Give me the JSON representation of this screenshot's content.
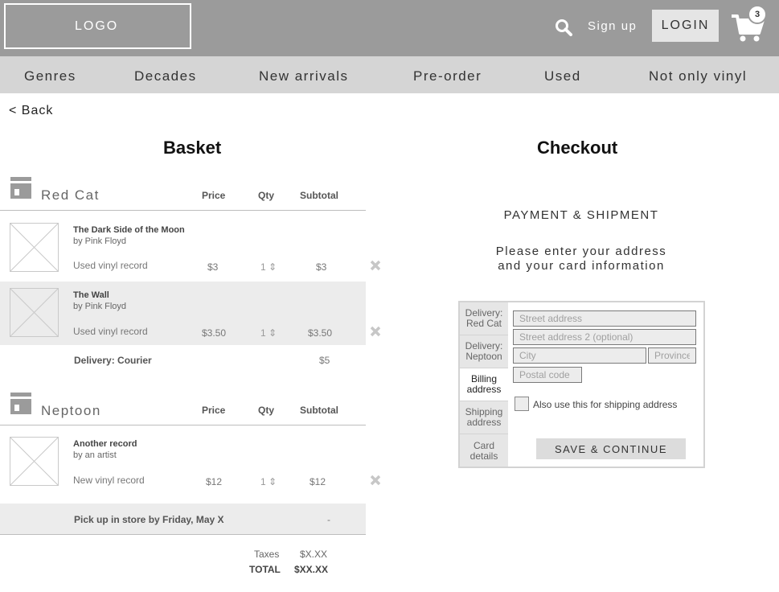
{
  "header": {
    "logo_text": "LOGO",
    "signup_label": "Sign up",
    "login_label": "LOGIN",
    "cart_count": "3",
    "icons": [
      "search-icon",
      "cart-icon"
    ]
  },
  "nav": {
    "items": [
      "Genres",
      "Decades",
      "New arrivals",
      "Pre-order",
      "Used",
      "Not only vinyl"
    ]
  },
  "back_label": "< Back",
  "basket": {
    "title": "Basket",
    "columns": {
      "price": "Price",
      "qty": "Qty",
      "subtotal": "Subtotal"
    },
    "stores": [
      {
        "name": "Red Cat",
        "items": [
          {
            "title": "The Dark Side of the Moon",
            "artist": "by Pink Floyd",
            "type": "Used vinyl record",
            "price": "$3",
            "qty": "1",
            "subtotal": "$3"
          },
          {
            "title": "The Wall",
            "artist": "by Pink Floyd",
            "type": "Used vinyl record",
            "price": "$3.50",
            "qty": "1",
            "subtotal": "$3.50"
          }
        ],
        "delivery_label": "Delivery: Courier",
        "delivery_cost": "$5"
      },
      {
        "name": "Neptoon",
        "items": [
          {
            "title": "Another record",
            "artist": "by an artist",
            "type": "New vinyl record",
            "price": "$12",
            "qty": "1",
            "subtotal": "$12"
          }
        ],
        "delivery_label": "Pick up in store by Friday, May X",
        "delivery_cost": "-"
      }
    ],
    "taxes_label": "Taxes",
    "taxes_value": "$X.XX",
    "total_label": "TOTAL",
    "total_value": "$XX.XX"
  },
  "checkout": {
    "title": "Checkout",
    "subtitle": "PAYMENT & SHIPMENT",
    "instruction_line1": "Please enter your address",
    "instruction_line2": "and your card information",
    "tabs": [
      "Delivery:\nRed Cat",
      "Delivery:\nNeptoon",
      "Billing\naddress",
      "Shipping\naddress",
      "Card\ndetails"
    ],
    "active_tab": "Billing address",
    "form": {
      "street_placeholder": "Street address",
      "street2_placeholder": "Street address 2 (optional)",
      "city_placeholder": "City",
      "province_placeholder": "Province",
      "postal_placeholder": "Postal code",
      "checkbox_label": "Also use this for shipping address",
      "save_label": "SAVE & CONTINUE"
    }
  }
}
